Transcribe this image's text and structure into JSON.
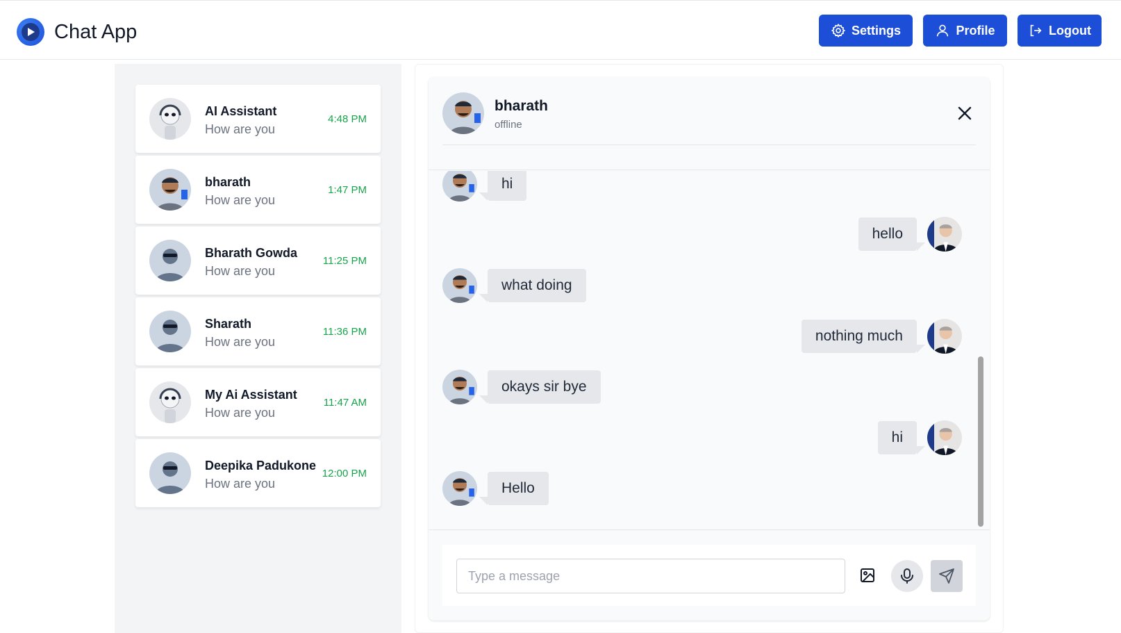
{
  "header": {
    "app_title": "Chat App",
    "settings_label": "Settings",
    "profile_label": "Profile",
    "logout_label": "Logout",
    "accent_color": "#1d4ed8"
  },
  "contacts": [
    {
      "name": "AI Assistant",
      "preview": "How are you",
      "time": "4:48 PM",
      "avatar": "robot-avatar"
    },
    {
      "name": "bharath",
      "preview": "How are you",
      "time": "1:47 PM",
      "avatar": "photo-avatar-bharath"
    },
    {
      "name": "Bharath Gowda",
      "preview": "How are you",
      "time": "11:25 PM",
      "avatar": "default-user-avatar"
    },
    {
      "name": "Sharath",
      "preview": "How are you",
      "time": "11:36 PM",
      "avatar": "default-user-avatar"
    },
    {
      "name": "My Ai Assistant",
      "preview": "How are you",
      "time": "11:47 AM",
      "avatar": "robot-avatar"
    },
    {
      "name": "Deepika Padukone",
      "preview": "How are you",
      "time": "12:00 PM",
      "avatar": "default-user-avatar"
    }
  ],
  "chat": {
    "name": "bharath",
    "status": "offline",
    "messages": [
      {
        "side": "left",
        "text": "hi"
      },
      {
        "side": "right",
        "text": "hello"
      },
      {
        "side": "left",
        "text": "what doing"
      },
      {
        "side": "right",
        "text": "nothing much"
      },
      {
        "side": "left",
        "text": "okays sir bye"
      },
      {
        "side": "right",
        "text": "hi"
      },
      {
        "side": "left",
        "text": "Hello"
      }
    ]
  },
  "composer": {
    "placeholder": "Type a message",
    "value": ""
  }
}
